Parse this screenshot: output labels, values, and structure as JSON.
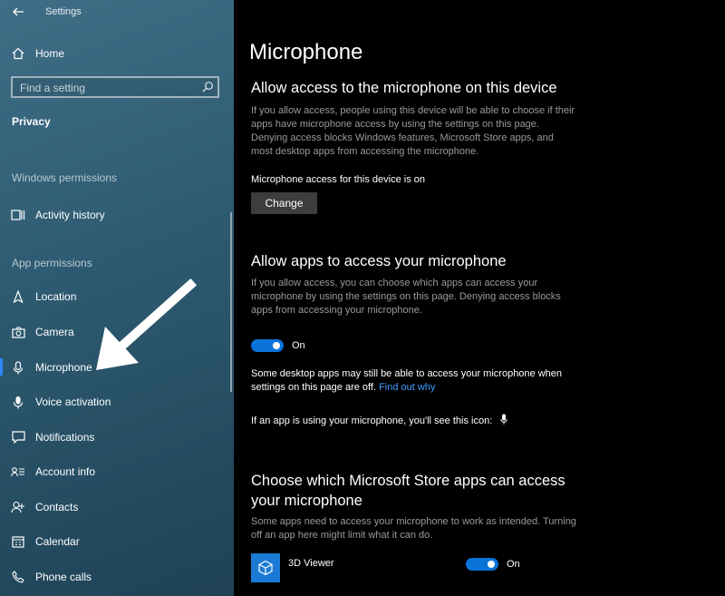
{
  "window": {
    "title": "Settings"
  },
  "sidebar": {
    "home_label": "Home",
    "search_placeholder": "Find a setting",
    "category": "Privacy",
    "section_windows": "Windows permissions",
    "section_app": "App permissions",
    "items": [
      {
        "label": "Activity history",
        "icon": "activity-history-icon"
      },
      {
        "label": "Location",
        "icon": "location-icon"
      },
      {
        "label": "Camera",
        "icon": "camera-icon"
      },
      {
        "label": "Microphone",
        "icon": "microphone-icon",
        "selected": true
      },
      {
        "label": "Voice activation",
        "icon": "voice-activation-icon"
      },
      {
        "label": "Notifications",
        "icon": "notifications-icon"
      },
      {
        "label": "Account info",
        "icon": "account-info-icon"
      },
      {
        "label": "Contacts",
        "icon": "contacts-icon"
      },
      {
        "label": "Calendar",
        "icon": "calendar-icon"
      },
      {
        "label": "Phone calls",
        "icon": "phone-calls-icon"
      }
    ]
  },
  "main": {
    "title": "Microphone",
    "device": {
      "heading": "Allow access to the microphone on this device",
      "description": "If you allow access, people using this device will be able to choose if their apps have microphone access by using the settings on this page. Denying access blocks Windows features, Microsoft Store apps, and most desktop apps from accessing the microphone.",
      "status": "Microphone access for this device is on",
      "change_button": "Change"
    },
    "apps": {
      "heading": "Allow apps to access your microphone",
      "description": "If you allow access, you can choose which apps can access your microphone by using the settings on this page. Denying access blocks apps from accessing your microphone.",
      "toggle_label": "On",
      "note": "Some desktop apps may still be able to access your microphone when settings on this page are off.",
      "note_link": "Find out why",
      "icon_note": "If an app is using your microphone, you'll see this icon:"
    },
    "store": {
      "heading_line1": "Choose which Microsoft Store apps can access",
      "heading_line2": "your microphone",
      "description": "Some apps need to access your microphone to work as intended. Turning off an app here might limit what it can do.",
      "app_name": "3D Viewer",
      "app_toggle_label": "On"
    }
  },
  "colors": {
    "accent": "#0a73d8",
    "link": "#3c9bff"
  }
}
